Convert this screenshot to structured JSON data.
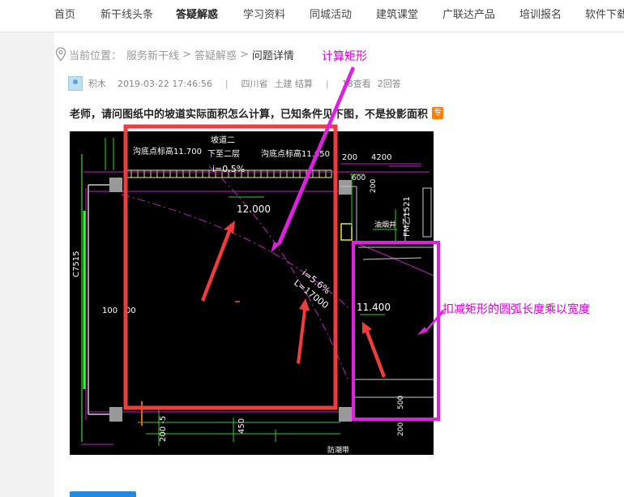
{
  "nav": {
    "items": [
      "首页",
      "新干线头条",
      "答疑解惑",
      "学习资料",
      "同城活动",
      "建筑课堂",
      "广联达产品",
      "培训报名",
      "软件下载"
    ],
    "active_index": 2
  },
  "breadcrumb": {
    "prefix": "当前位置：",
    "links": [
      "服务新干线",
      "答疑解惑"
    ],
    "separator": ">",
    "current": "问题详情"
  },
  "meta": {
    "user": "积木",
    "datetime": "2019-03-22 17:46:56",
    "divider": "|",
    "region": "四川省",
    "category": "土建 结算",
    "views": "18查看",
    "answers": "2回答"
  },
  "question": {
    "title": "老师，请问图纸中的坡道实际面积怎么计算，已知条件见下图，不是投影面积",
    "badge": "专"
  },
  "drawing": {
    "labels": {
      "slope_name": "坡道二",
      "floor": "下至二层",
      "slope_top": "i=0.5%",
      "elev_left": "沟底点标高11.700",
      "elev_right": "沟底点标高11.650",
      "dim_200": "200",
      "dim_4200": "4200",
      "elev_12": "12.000",
      "slope_mid": "i=5.6%",
      "length": "L=17000",
      "elev_114": "11.400",
      "wall_label": "C7515",
      "dim_100_left": "100",
      "dim_100_right": "00",
      "door": "FM乙1521",
      "dim_500": "500",
      "dim_200_bottom": "200",
      "dim_450": "450",
      "dim_200_5": "200 -5",
      "bottom_label": "防潮带",
      "drain": "油烟井",
      "dim_600": "600",
      "dim_200_right": "200"
    }
  },
  "annotations": {
    "calc_rect": "计算矩形",
    "deduct": "扣减矩形的圆弧长度乘以宽度"
  },
  "colors": {
    "red_frame": "#f03c3c",
    "magenta": "#e020e0",
    "arrow_red": "#f03c3c"
  }
}
